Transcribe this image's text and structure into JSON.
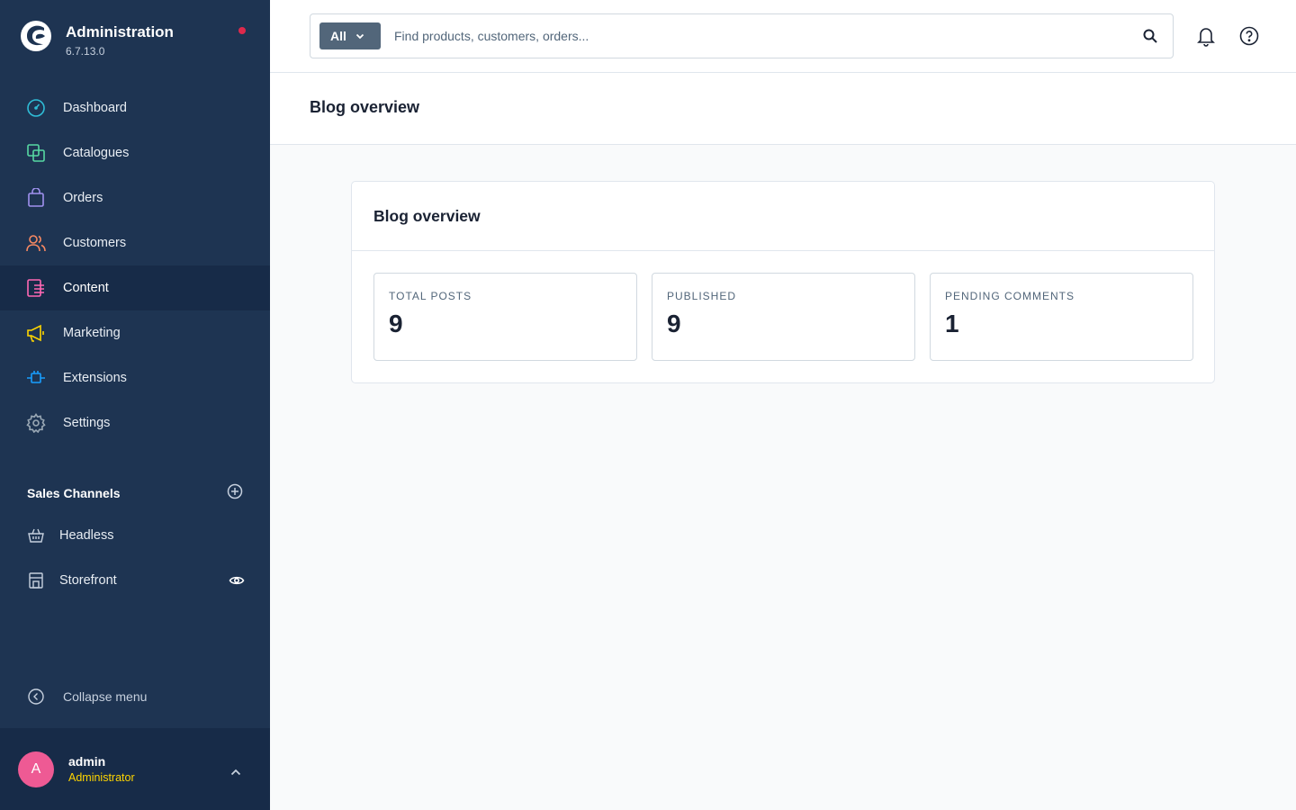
{
  "app": {
    "title": "Administration",
    "version": "6.7.13.0"
  },
  "nav": [
    {
      "label": "Dashboard",
      "icon": "dashboard-icon",
      "color": "#2fbcd6"
    },
    {
      "label": "Catalogues",
      "icon": "catalogues-icon",
      "color": "#57d9a3"
    },
    {
      "label": "Orders",
      "icon": "orders-icon",
      "color": "#a092f0"
    },
    {
      "label": "Customers",
      "icon": "customers-icon",
      "color": "#f88962"
    },
    {
      "label": "Content",
      "icon": "content-icon",
      "color": "#ff68b4"
    },
    {
      "label": "Marketing",
      "icon": "marketing-icon",
      "color": "#ffd700"
    },
    {
      "label": "Extensions",
      "icon": "extensions-icon",
      "color": "#189eff"
    },
    {
      "label": "Settings",
      "icon": "settings-icon",
      "color": "#9aa8b5"
    }
  ],
  "active_nav": "Content",
  "sales_channels": {
    "title": "Sales Channels",
    "items": [
      {
        "label": "Headless",
        "icon": "basket-icon"
      },
      {
        "label": "Storefront",
        "icon": "storefront-icon"
      }
    ]
  },
  "collapse_label": "Collapse menu",
  "user": {
    "initial": "A",
    "name": "admin",
    "role": "Administrator"
  },
  "search": {
    "type_label": "All",
    "placeholder": "Find products, customers, orders..."
  },
  "page": {
    "title": "Blog overview"
  },
  "card": {
    "title": "Blog overview",
    "stats": [
      {
        "label": "TOTAL POSTS",
        "value": "9"
      },
      {
        "label": "PUBLISHED",
        "value": "9"
      },
      {
        "label": "PENDING COMMENTS",
        "value": "1"
      }
    ]
  },
  "colors": {
    "sidebar": "#1e3452",
    "sidebar_active": "#172b48",
    "accent": "#189eff",
    "notification_dot": "#de294c",
    "avatar": "#ee5a94",
    "role": "#ffd500"
  }
}
